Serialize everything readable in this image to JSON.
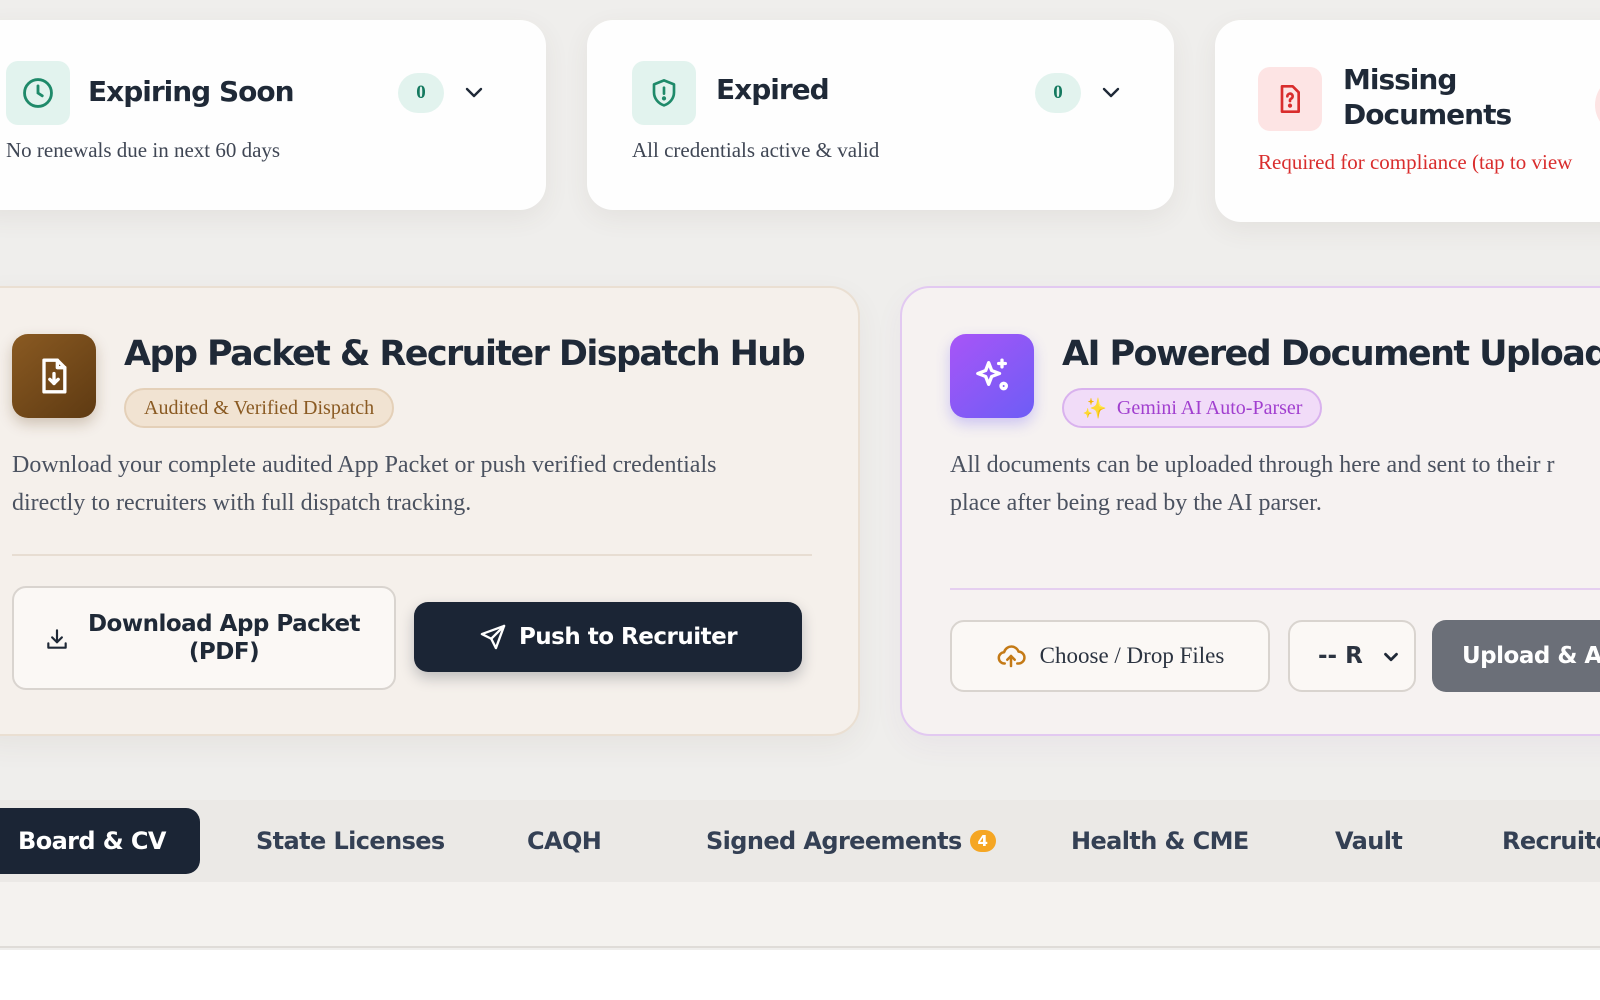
{
  "status_cards": {
    "expiring": {
      "title": "Expiring Soon",
      "count": "0",
      "subtitle": "No renewals due in next 60 days",
      "icon": "clock-icon"
    },
    "expired": {
      "title": "Expired",
      "count": "0",
      "subtitle": "All credentials active & valid",
      "icon": "shield-alert-icon"
    },
    "missing": {
      "title_line1": "Missing",
      "title_line2": "Documents",
      "subtitle": "Required for compliance (tap to view",
      "icon": "file-question-icon"
    }
  },
  "dispatch_hub": {
    "title": "App Packet & Recruiter Dispatch Hub",
    "tag": "Audited & Verified Dispatch",
    "description_line1": "Download your complete audited App Packet or push verified credentials",
    "description_line2": "directly to recruiters with full dispatch tracking.",
    "download_label_line1": "Download App Packet",
    "download_label_line2": "(PDF)",
    "push_label": "Push to Recruiter"
  },
  "ai_uploader": {
    "title": "AI Powered Document Uploader",
    "tag": "Gemini AI Auto-Parser",
    "tag_emoji": "✨",
    "description_line1": "All documents can be uploaded through here and sent to their r",
    "description_line2": "place after being read by the AI parser.",
    "choose_label": "Choose / Drop Files",
    "select_value": "-- R",
    "upload_label": "Upload & Au"
  },
  "tabs": [
    {
      "label": "Board & CV",
      "active": true
    },
    {
      "label": "State Licenses"
    },
    {
      "label": "CAQH"
    },
    {
      "label": "Signed Agreements",
      "badge": "4"
    },
    {
      "label": "Health & CME"
    },
    {
      "label": "Vault"
    },
    {
      "label": "Recruiter"
    }
  ],
  "colors": {
    "accent_dark": "#1b2535",
    "success_green": "#14795f",
    "danger_red": "#d92d2d",
    "brand_brown": "#8a5a22",
    "ai_purple": "#a855f7",
    "badge_orange": "#f5a623"
  }
}
